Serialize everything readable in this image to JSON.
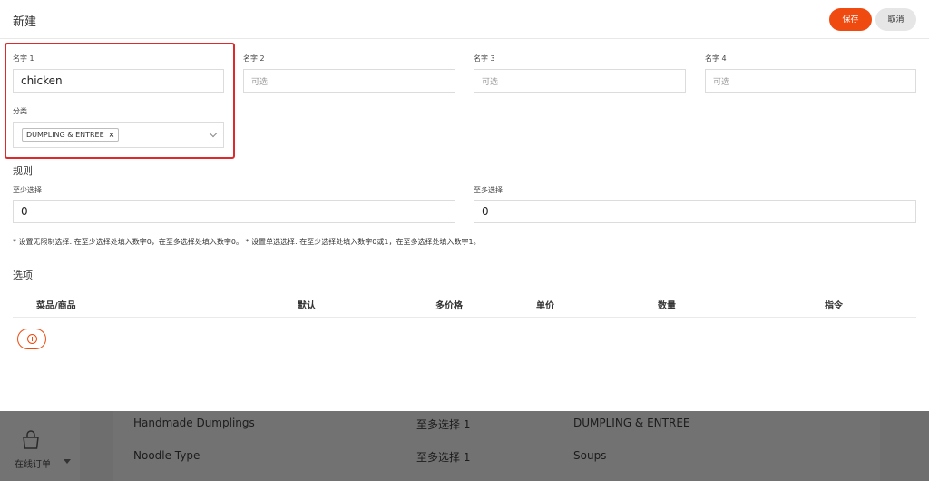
{
  "modal": {
    "title": "新建",
    "save_label": "保存",
    "cancel_label": "取消"
  },
  "names": [
    {
      "label": "名字 1",
      "value": "chicken",
      "placeholder": ""
    },
    {
      "label": "名字 2",
      "value": "",
      "placeholder": "可选"
    },
    {
      "label": "名字 3",
      "value": "",
      "placeholder": "可选"
    },
    {
      "label": "名字 4",
      "value": "",
      "placeholder": "可选"
    }
  ],
  "category": {
    "label": "分类",
    "selected_tag": "DUMPLING & ENTREE",
    "tag_remove": "×"
  },
  "rules": {
    "title": "规则",
    "min_label": "至少选择",
    "min_value": "0",
    "max_label": "至多选择",
    "max_value": "0",
    "note": "* 设置无限制选择: 在至少选择处填入数字0，在至多选择处填入数字0。 * 设置单选选择: 在至少选择处填入数字0或1，在至多选择处填入数字1。"
  },
  "options": {
    "title": "选项",
    "columns": [
      "菜品/商品",
      "默认",
      "多价格",
      "单价",
      "数量",
      "指令"
    ]
  },
  "background": {
    "nav_label": "在线订单",
    "rows": [
      {
        "name": "Handmade Dumplings",
        "rule": "至多选择 1",
        "category": "DUMPLING & ENTREE"
      },
      {
        "name": "Noodle Type",
        "rule": "至多选择 1",
        "category": "Soups"
      }
    ]
  },
  "colors": {
    "accent": "#ef4a0f",
    "highlight": "#e0292c"
  }
}
